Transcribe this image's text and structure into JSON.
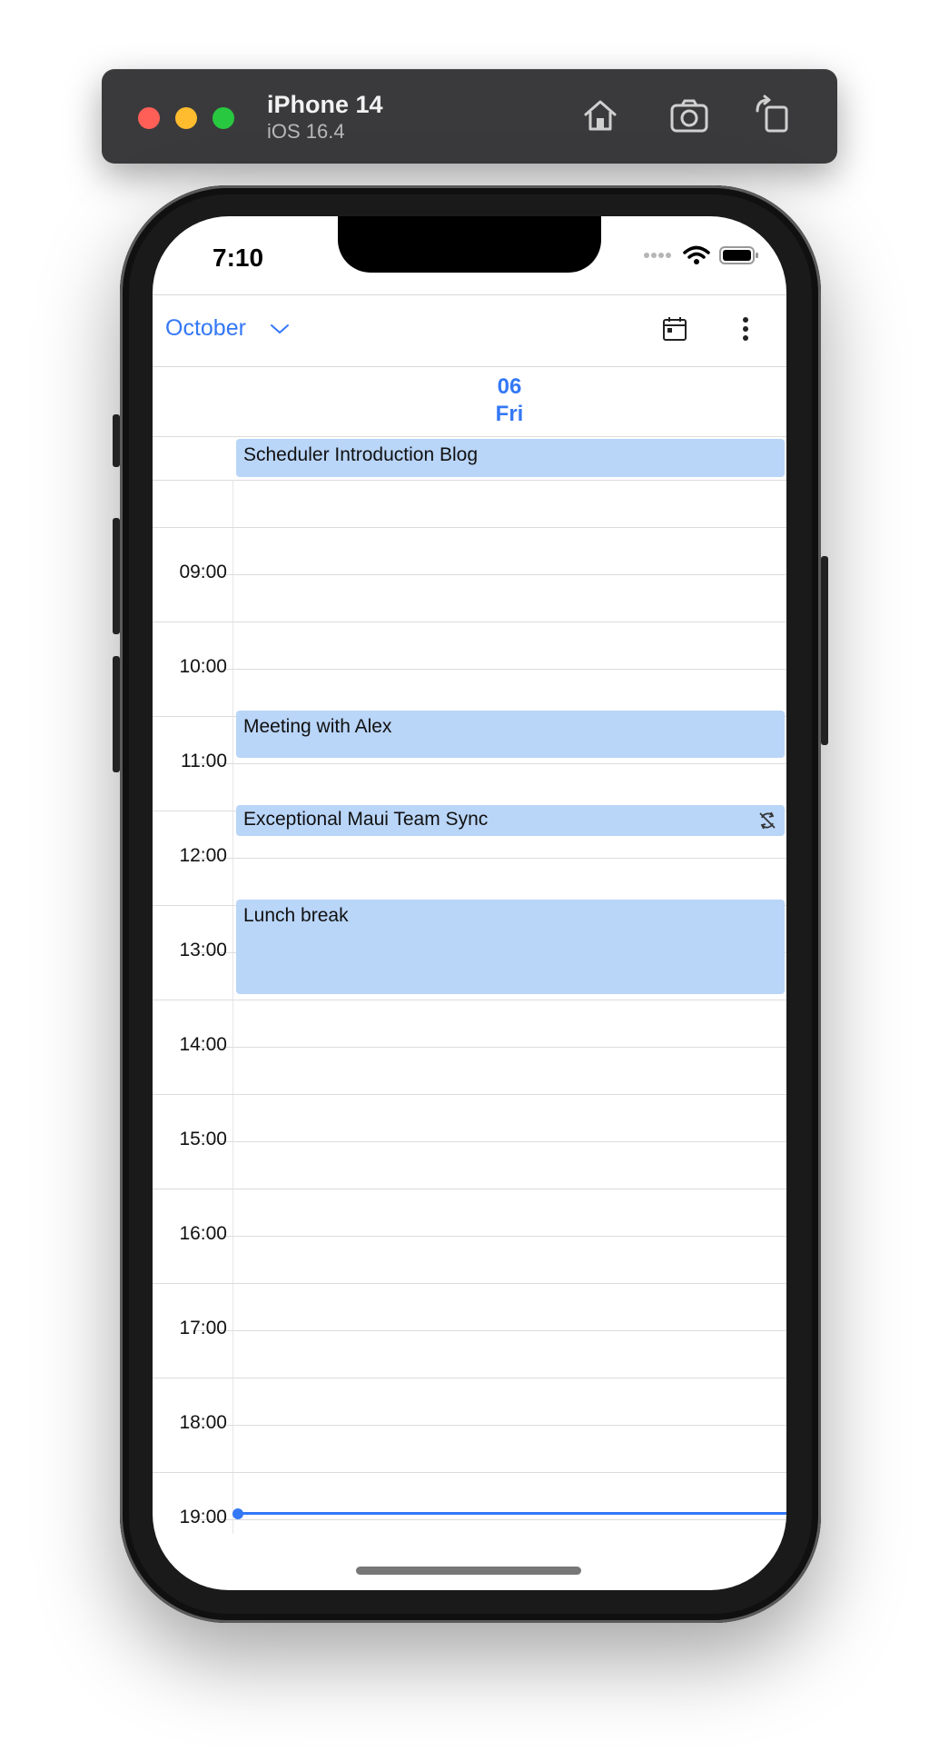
{
  "simulator": {
    "device_name": "iPhone 14",
    "os_version": "iOS 16.4"
  },
  "status_bar": {
    "time": "7:10"
  },
  "header": {
    "month": "October"
  },
  "day": {
    "number": "06",
    "name": "Fri"
  },
  "all_day_events": [
    {
      "title": "Scheduler Introduction Blog"
    }
  ],
  "time_labels": [
    "09:00",
    "10:00",
    "11:00",
    "12:00",
    "13:00",
    "14:00",
    "15:00",
    "16:00",
    "17:00",
    "18:00",
    "19:00"
  ],
  "events": [
    {
      "title": "Meeting with Alex"
    },
    {
      "title": "Exceptional Maui Team Sync"
    },
    {
      "title": "Lunch break"
    }
  ],
  "colors": {
    "accent": "#3478f6",
    "event_bg": "#b9d5f8",
    "sim_bar": "#3a3a3c"
  }
}
